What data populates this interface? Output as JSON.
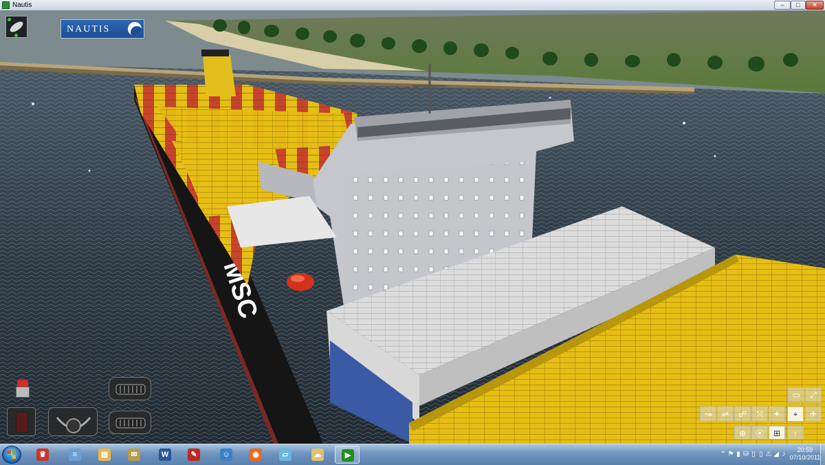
{
  "window": {
    "title": "Nautis",
    "min_glyph": "–",
    "max_glyph": "□",
    "close_glyph": "✕"
  },
  "hud": {
    "logo_text": "NAUTIS",
    "ship_hull_lettering": "MSC",
    "ship_view_icon": "ship-thumbnail-icon",
    "camera_tools": [
      {
        "name": "camera-tool-1",
        "glyph": "▭"
      },
      {
        "name": "camera-tool-2",
        "glyph": "⤢"
      },
      {
        "name": "camera-tool-3",
        "glyph": "↝"
      },
      {
        "name": "camera-tool-4",
        "glyph": "⇌"
      },
      {
        "name": "camera-tool-5",
        "glyph": "☍"
      },
      {
        "name": "camera-tool-6",
        "glyph": "⤧"
      },
      {
        "name": "camera-tool-7",
        "glyph": "✦"
      },
      {
        "name": "camera-tool-8",
        "glyph": "⌖"
      },
      {
        "name": "camera-tool-9",
        "glyph": "✈"
      },
      {
        "name": "camera-tool-10",
        "glyph": "⊕"
      },
      {
        "name": "camera-tool-11",
        "glyph": "⦿"
      },
      {
        "name": "camera-tool-12",
        "glyph": "⊞"
      },
      {
        "name": "camera-tool-13",
        "glyph": "↑"
      }
    ]
  },
  "taskbar": {
    "apps": [
      {
        "name": "taskbar-app-launcher",
        "glyph": "♛",
        "color": "#c8372d"
      },
      {
        "name": "taskbar-app-notepad",
        "glyph": "≡",
        "color": "#6aa0d8"
      },
      {
        "name": "taskbar-app-explorer",
        "glyph": "▤",
        "color": "#e8b84a"
      },
      {
        "name": "taskbar-app-chat",
        "glyph": "✉",
        "color": "#b99b4e"
      },
      {
        "name": "taskbar-app-word",
        "glyph": "W",
        "color": "#2b5797"
      },
      {
        "name": "taskbar-app-pdf",
        "glyph": "✎",
        "color": "#c0281f"
      },
      {
        "name": "taskbar-app-messenger",
        "glyph": "☺",
        "color": "#3b82c4"
      },
      {
        "name": "taskbar-app-firefox",
        "glyph": "◉",
        "color": "#e66a1e"
      },
      {
        "name": "taskbar-app-media",
        "glyph": "▱",
        "color": "#6cb5e0"
      },
      {
        "name": "taskbar-app-weather",
        "glyph": "☁",
        "color": "#e0c074"
      },
      {
        "name": "taskbar-app-nautis",
        "glyph": "▶",
        "color": "#1f8f1f"
      }
    ],
    "tray_icons": [
      "⌃",
      "⚑",
      "▮",
      "⛁",
      "▯",
      "▯",
      "⚠",
      "◢",
      "♪"
    ],
    "time": "20:59",
    "date": "07/10/2011"
  },
  "colors": {
    "container_yellow": "#e6be14",
    "container_red": "#c9432c",
    "container_blue": "#4666b8",
    "hull": "#111111",
    "superstructure": "#c9cbd0",
    "water": "#2d3842"
  }
}
